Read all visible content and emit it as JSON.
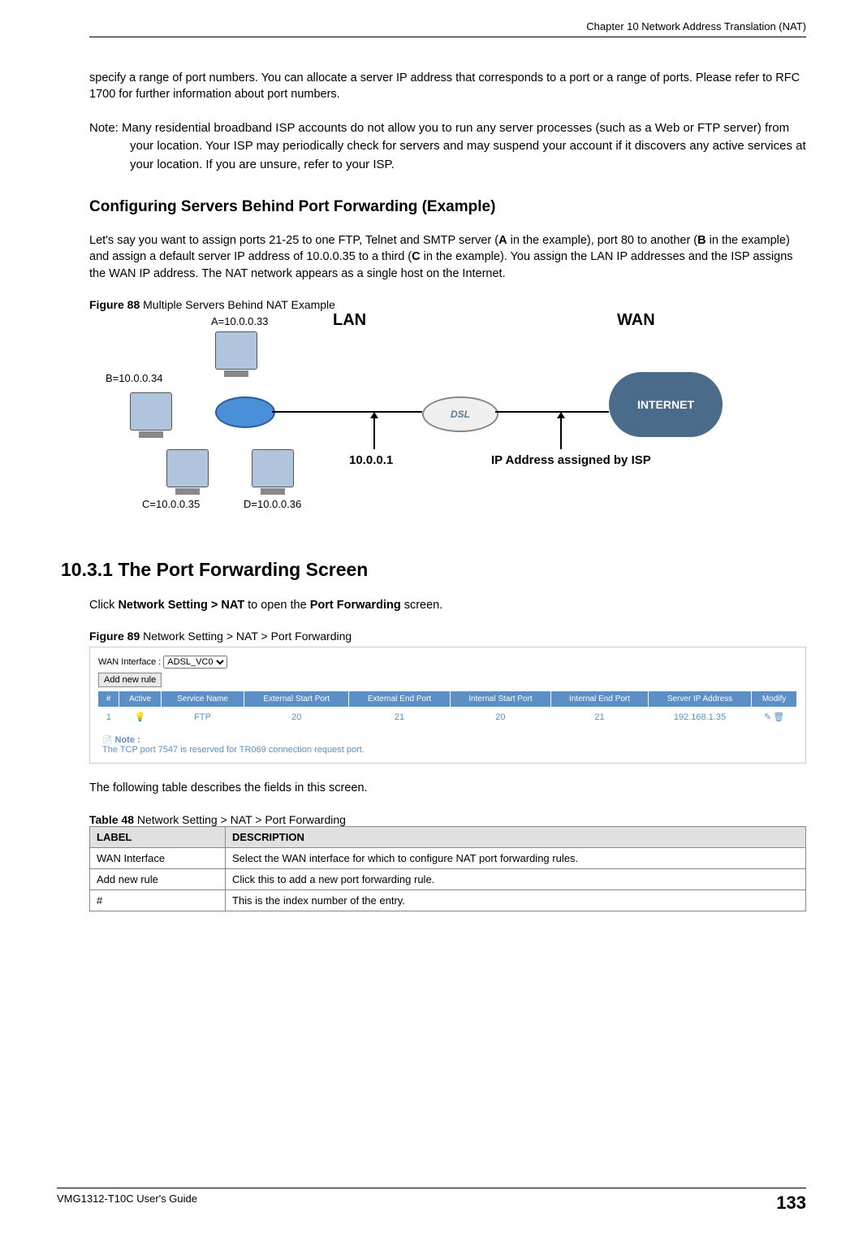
{
  "header": {
    "chapter": "Chapter 10 Network Address Translation (NAT)"
  },
  "intro": {
    "p1": "specify a range of port numbers. You can allocate a server IP address that corresponds to a port or a range of ports. Please refer to RFC 1700 for further information about port numbers.",
    "note": "Note: Many residential broadband ISP accounts do not allow you to run any server processes (such as a Web or FTP server) from your location. Your ISP may periodically check for servers and may suspend your account if it discovers any active services at your location. If you are unsure, refer to your ISP."
  },
  "section1": {
    "heading": "Configuring Servers Behind Port Forwarding (Example)",
    "p1_part1": "Let's say you want to assign ports 21-25 to one FTP, Telnet and SMTP server (",
    "p1_bold1": "A",
    "p1_part2": " in the example), port 80 to another (",
    "p1_bold2": "B",
    "p1_part3": " in the example) and assign a default server IP address of 10.0.0.35 to a third (",
    "p1_bold3": "C",
    "p1_part4": " in the example). You assign the LAN IP addresses and the ISP assigns the WAN IP address. The NAT network appears as a single host on the Internet."
  },
  "figure88": {
    "prefix": "Figure 88   ",
    "caption": "Multiple Servers Behind NAT Example",
    "labels": {
      "a": "A=10.0.0.33",
      "b": "B=10.0.0.34",
      "c": "C=10.0.0.35",
      "d": "D=10.0.0.36",
      "lan": "LAN",
      "wan": "WAN",
      "gw": "10.0.0.1",
      "isp": "IP Address assigned by ISP",
      "dsl": "DSL",
      "internet": "INTERNET"
    }
  },
  "section2": {
    "heading": "10.3.1  The Port Forwarding Screen",
    "p1_part1": "Click ",
    "p1_bold1": "Network Setting > NAT",
    "p1_part2": " to open the ",
    "p1_bold2": "Port Forwarding",
    "p1_part3": " screen."
  },
  "figure89": {
    "prefix": "Figure 89   ",
    "caption": "Network Setting > NAT > Port Forwarding",
    "ui": {
      "wan_interface_label": "WAN Interface :",
      "wan_interface_value": "ADSL_VC0",
      "add_rule_btn": "Add new rule",
      "columns": {
        "num": "#",
        "active": "Active",
        "service": "Service Name",
        "ext_start": "External Start Port",
        "ext_end": "External End Port",
        "int_start": "Internal Start Port",
        "int_end": "Internal End Port",
        "server_ip": "Server IP Address",
        "modify": "Modify"
      },
      "row1": {
        "num": "1",
        "service": "FTP",
        "ext_start": "20",
        "ext_end": "21",
        "int_start": "20",
        "int_end": "21",
        "server_ip": "192.168.1.35"
      },
      "note_label": "Note :",
      "note_text": "The TCP port 7547 is reserved for TR069 connection request port."
    }
  },
  "table_intro": "The following table describes the fields in this screen.",
  "table48": {
    "prefix": "Table 48   ",
    "caption": "Network Setting > NAT > Port Forwarding",
    "headers": {
      "label": "LABEL",
      "desc": "DESCRIPTION"
    },
    "rows": [
      {
        "label": "WAN Interface",
        "desc": "Select the WAN interface for which to configure NAT port forwarding rules."
      },
      {
        "label": "Add new rule",
        "desc": "Click this to add a new port forwarding rule."
      },
      {
        "label": "#",
        "desc": "This is the index number of the entry."
      }
    ]
  },
  "footer": {
    "guide": "VMG1312-T10C User's Guide",
    "page": "133"
  }
}
